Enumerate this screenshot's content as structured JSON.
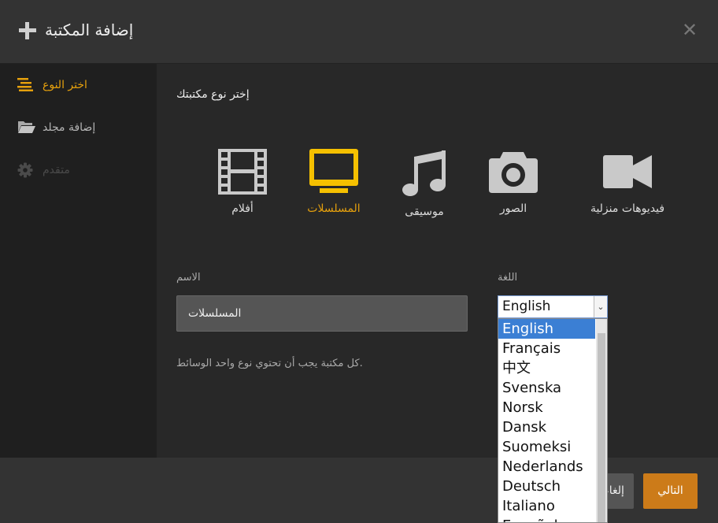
{
  "header": {
    "title": "إضافة المكتبة"
  },
  "sidebar": {
    "items": [
      {
        "label": "اختر النوع",
        "state": "active"
      },
      {
        "label": "إضافة مجلد",
        "state": "normal"
      },
      {
        "label": "متقدم",
        "state": "disabled"
      }
    ]
  },
  "main": {
    "section_title": "إختر نوع مكتبتك",
    "types": [
      {
        "label": "أفلام",
        "icon": "film-icon",
        "selected": false
      },
      {
        "label": "المسلسلات",
        "icon": "tv-icon",
        "selected": true
      },
      {
        "label": "موسيقى",
        "icon": "music-icon",
        "selected": false
      },
      {
        "label": "الصور",
        "icon": "camera-icon",
        "selected": false
      },
      {
        "label": "فيديوهات منزلية",
        "icon": "video-camera-icon",
        "selected": false
      }
    ],
    "name_label": "الاسم",
    "name_value": "المسلسلات",
    "language_label": "اللغة",
    "language_value": "English",
    "hint": "كل مكتبة يجب أن تحتوي نوع واحد الوسائط."
  },
  "dropdown": {
    "options": [
      "English",
      "Français",
      "中文",
      "Svenska",
      "Norsk",
      "Dansk",
      "Suomeksi",
      "Nederlands",
      "Deutsch",
      "Italiano",
      "Español"
    ]
  },
  "footer": {
    "cancel_label": "إلغاء",
    "next_label": "التالي"
  },
  "colors": {
    "accent": "#e5a00d",
    "next_button": "#cc7b19"
  }
}
